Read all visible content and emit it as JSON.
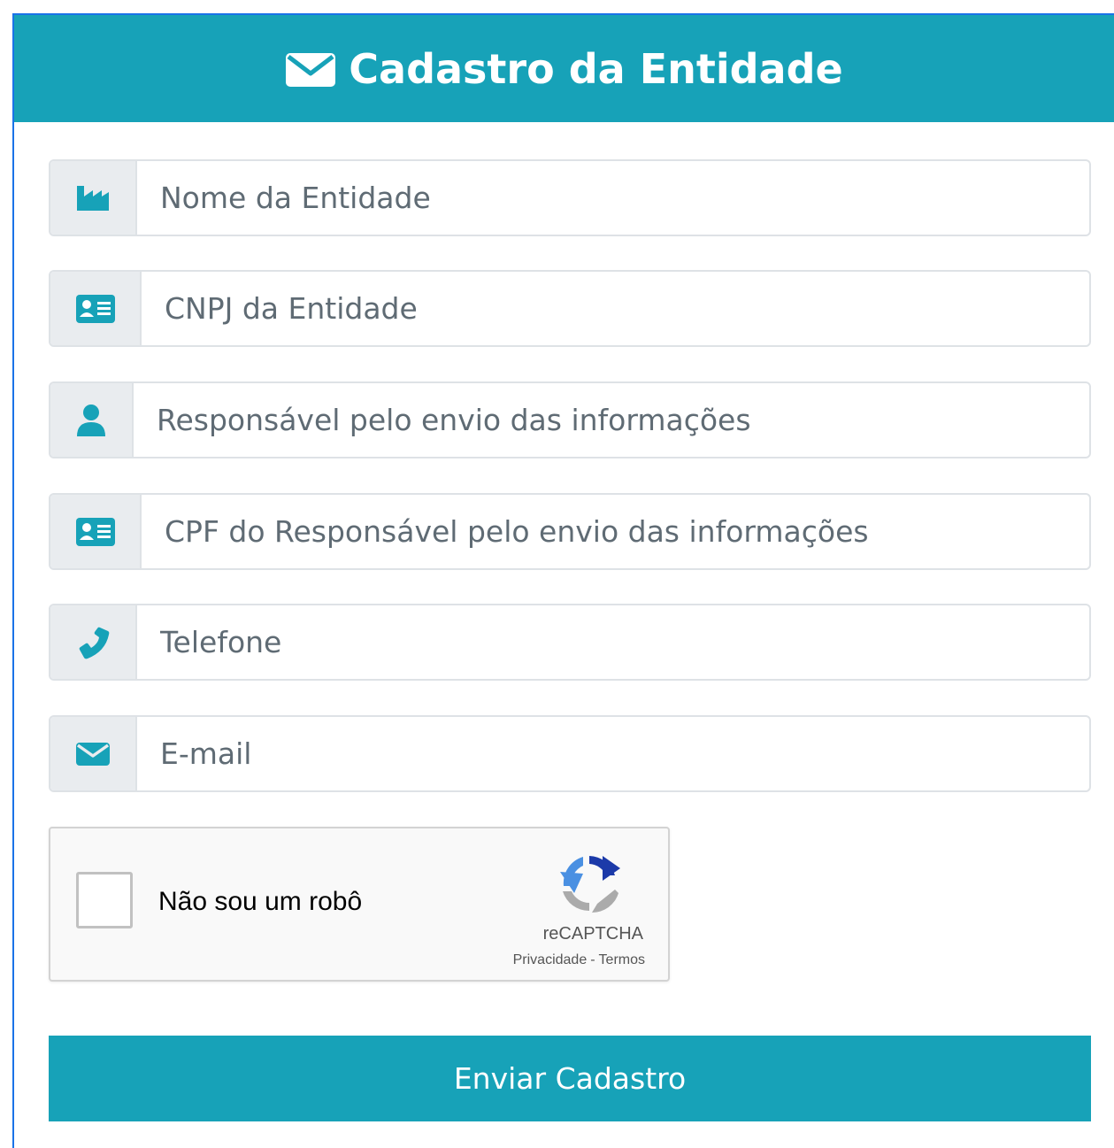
{
  "header": {
    "icon": "envelope-icon",
    "title": "Cadastro da Entidade"
  },
  "form": {
    "fields": [
      {
        "icon": "industry-icon",
        "placeholder": "Nome da Entidade",
        "value": ""
      },
      {
        "icon": "id-card-icon",
        "placeholder": "CNPJ da Entidade",
        "value": ""
      },
      {
        "icon": "user-icon",
        "placeholder": "Responsável pelo envio das informações",
        "value": ""
      },
      {
        "icon": "id-card-icon",
        "placeholder": "CPF do Responsável pelo envio das informações",
        "value": ""
      },
      {
        "icon": "phone-icon",
        "placeholder": "Telefone",
        "value": ""
      },
      {
        "icon": "envelope-icon",
        "placeholder": "E-mail",
        "value": ""
      }
    ]
  },
  "recaptcha": {
    "checked": false,
    "label": "Não sou um robô",
    "brand": "reCAPTCHA",
    "privacy": "Privacidade",
    "separator": "-",
    "terms": "Termos"
  },
  "submit": {
    "label": "Enviar Cadastro"
  },
  "colors": {
    "primary": "#17a2b8",
    "icon": "#17a2b8",
    "addon_bg": "#e9ecef",
    "border": "#dee2e6"
  }
}
